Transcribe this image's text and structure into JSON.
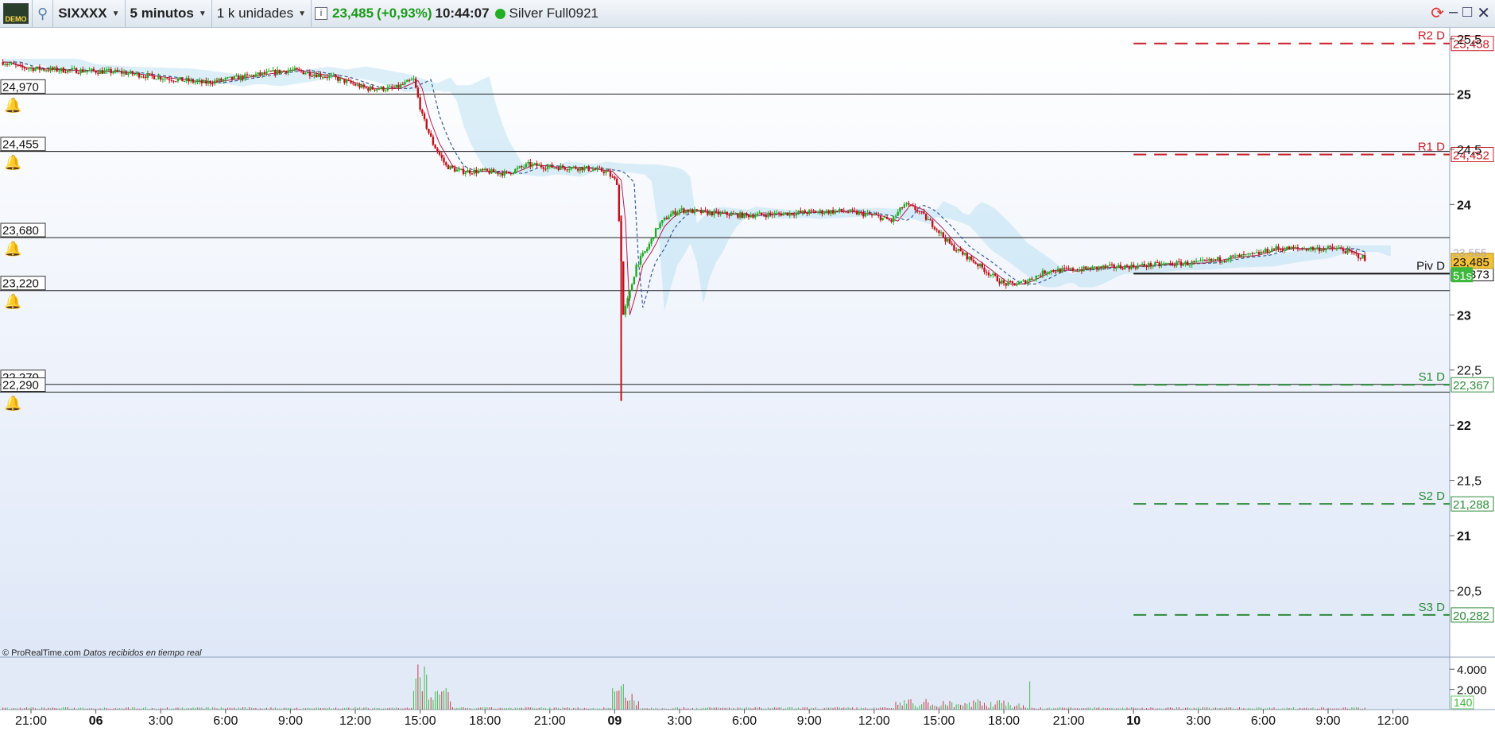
{
  "toolbar": {
    "demo_label": "DEMO",
    "symbol": "SIXXXX",
    "timeframe": "5 minutos",
    "units": "1 k unidades",
    "price": "23,485",
    "change": "(+0,93%)",
    "time": "10:44:07",
    "status": "Silver Full0921"
  },
  "colors": {
    "up": "#1faa1f",
    "down": "#c0101a",
    "resistance": "#c8202a",
    "support": "#2e8b3a",
    "pivot": "#111111"
  },
  "credit": "© ProRealTime.com",
  "credit_note": "Datos recibidos en tiempo real",
  "chart_data": {
    "type": "candlestick",
    "ylim": [
      19.9,
      25.6
    ],
    "yticks": [
      {
        "v": 25.5,
        "label": "25,5"
      },
      {
        "v": 25,
        "label": "25"
      },
      {
        "v": 24.5,
        "label": "24,5"
      },
      {
        "v": 24,
        "label": "24"
      },
      {
        "v": 23,
        "label": "23"
      },
      {
        "v": 22.5,
        "label": "22,5"
      },
      {
        "v": 22,
        "label": "22"
      },
      {
        "v": 21.5,
        "label": "21,5"
      },
      {
        "v": 21,
        "label": "21"
      },
      {
        "v": 20.5,
        "label": "20,5"
      }
    ],
    "xticks": [
      {
        "t": 0,
        "label": "21:00",
        "bold": false
      },
      {
        "t": 3,
        "label": "06",
        "bold": true
      },
      {
        "t": 6,
        "label": "3:00",
        "bold": false
      },
      {
        "t": 9,
        "label": "6:00",
        "bold": false
      },
      {
        "t": 12,
        "label": "9:00",
        "bold": false
      },
      {
        "t": 15,
        "label": "12:00",
        "bold": false
      },
      {
        "t": 18,
        "label": "15:00",
        "bold": false
      },
      {
        "t": 21,
        "label": "18:00",
        "bold": false
      },
      {
        "t": 24,
        "label": "21:00",
        "bold": false
      },
      {
        "t": 27,
        "label": "09",
        "bold": true
      },
      {
        "t": 30,
        "label": "3:00",
        "bold": false
      },
      {
        "t": 33,
        "label": "6:00",
        "bold": false
      },
      {
        "t": 36,
        "label": "9:00",
        "bold": false
      },
      {
        "t": 39,
        "label": "12:00",
        "bold": false
      },
      {
        "t": 42,
        "label": "15:00",
        "bold": false
      },
      {
        "t": 45,
        "label": "18:00",
        "bold": false
      },
      {
        "t": 48,
        "label": "21:00",
        "bold": false
      },
      {
        "t": 51,
        "label": "10",
        "bold": true
      },
      {
        "t": 54,
        "label": "3:00",
        "bold": false
      },
      {
        "t": 57,
        "label": "6:00",
        "bold": false
      },
      {
        "t": 60,
        "label": "9:00",
        "bold": false
      },
      {
        "t": 63,
        "label": "12:00",
        "bold": false
      }
    ],
    "price_path": [
      [
        -1.3,
        25.29
      ],
      [
        -0.5,
        25.24
      ],
      [
        1,
        25.22
      ],
      [
        4,
        25.2
      ],
      [
        6,
        25.15
      ],
      [
        8,
        25.1
      ],
      [
        10,
        25.16
      ],
      [
        12,
        25.22
      ],
      [
        14,
        25.15
      ],
      [
        15.5,
        25.05
      ],
      [
        16.8,
        25.05
      ],
      [
        17.7,
        25.13
      ],
      [
        18.1,
        24.8
      ],
      [
        18.6,
        24.55
      ],
      [
        19.2,
        24.35
      ],
      [
        19.8,
        24.3
      ],
      [
        21,
        24.3
      ],
      [
        22,
        24.28
      ],
      [
        23,
        24.36
      ],
      [
        24,
        24.34
      ],
      [
        25.5,
        24.33
      ],
      [
        26.6,
        24.3
      ],
      [
        27.1,
        24.2
      ],
      [
        27.3,
        23.5
      ],
      [
        27.4,
        23.0
      ],
      [
        27.7,
        23.2
      ],
      [
        28,
        23.45
      ],
      [
        28.5,
        23.6
      ],
      [
        29,
        23.8
      ],
      [
        29.5,
        23.9
      ],
      [
        30,
        23.95
      ],
      [
        31,
        23.93
      ],
      [
        33,
        23.9
      ],
      [
        35,
        23.92
      ],
      [
        36,
        23.93
      ],
      [
        37.5,
        23.94
      ],
      [
        39,
        23.9
      ],
      [
        39.8,
        23.85
      ],
      [
        40.4,
        24.0
      ],
      [
        41,
        23.95
      ],
      [
        41.8,
        23.8
      ],
      [
        42.6,
        23.62
      ],
      [
        43.5,
        23.5
      ],
      [
        44.5,
        23.35
      ],
      [
        45,
        23.28
      ],
      [
        45.7,
        23.28
      ],
      [
        46.3,
        23.33
      ],
      [
        47,
        23.4
      ],
      [
        48.5,
        23.41
      ],
      [
        49.5,
        23.43
      ],
      [
        51,
        23.44
      ],
      [
        52.5,
        23.46
      ],
      [
        54,
        23.47
      ],
      [
        55.5,
        23.52
      ],
      [
        56.5,
        23.54
      ],
      [
        57.5,
        23.6
      ],
      [
        59,
        23.6
      ],
      [
        60.5,
        23.6
      ],
      [
        61.2,
        23.55
      ],
      [
        61.6,
        23.52
      ],
      [
        61.8,
        23.47
      ]
    ],
    "wick_spike": {
      "t": 27.3,
      "high": 23.9,
      "low": 22.22
    },
    "horizontal_levels": [
      {
        "label": "24,970",
        "value": 25.0
      },
      {
        "label": "24,455",
        "value": 24.48
      },
      {
        "label": "23,680",
        "value": 23.7
      },
      {
        "label": "23,220",
        "value": 23.22
      },
      {
        "label": "22,270",
        "value": 22.37
      },
      {
        "label": "22,290",
        "value": 22.3
      }
    ],
    "pivot_lines": [
      {
        "name": "R2 D",
        "value": 25.458,
        "label": "25,458",
        "kind": "resistance"
      },
      {
        "name": "R1 D",
        "value": 24.452,
        "label": "24,452",
        "kind": "resistance"
      },
      {
        "name": "Piv D",
        "value": 23.373,
        "label": "23,373",
        "kind": "pivot"
      },
      {
        "name": "S1 D",
        "value": 22.367,
        "label": "22,367",
        "kind": "support"
      },
      {
        "name": "S2 D",
        "value": 21.288,
        "label": "21,288",
        "kind": "support"
      },
      {
        "name": "S3 D",
        "value": 20.282,
        "label": "20,282",
        "kind": "support"
      }
    ],
    "pivot_start_t": 51,
    "current_price_label": "23,485",
    "secondary_price_label": "23,555",
    "countdown_label": "51s",
    "volume": {
      "yticks": [
        {
          "v": 4000,
          "label": "4.000"
        },
        {
          "v": 2000,
          "label": "2.000"
        }
      ],
      "current_label": "140",
      "ymax": 5200
    }
  }
}
